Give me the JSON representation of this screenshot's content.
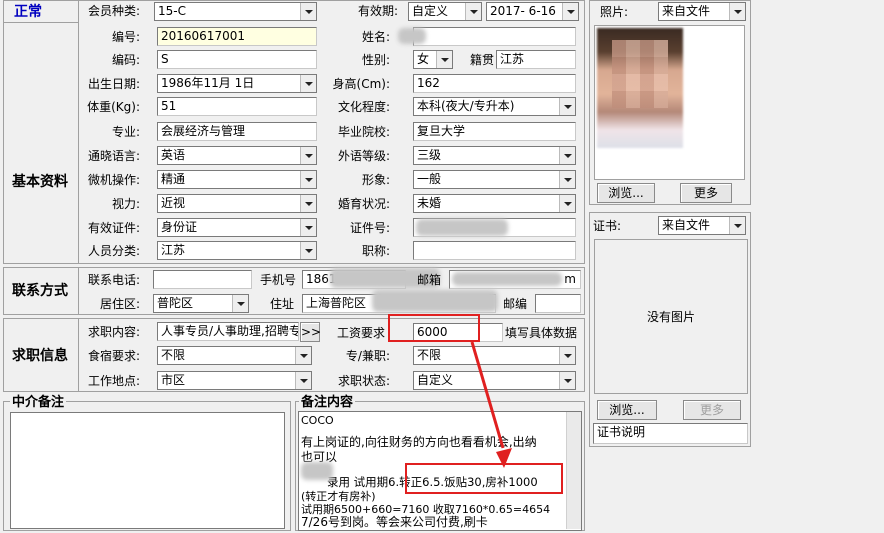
{
  "status": "正常",
  "fields": {
    "member_type_label": "会员种类:",
    "member_type": "15-C",
    "validity_label": "有效期:",
    "validity_select": "自定义",
    "validity_date": "2017- 6-16",
    "id_label": "编号:",
    "id_value": "20160617001",
    "name_label": "姓名:",
    "code_label": "编码:",
    "code_value": "S",
    "gender_label": "性别:",
    "gender_value": "女",
    "native_label": "籍贯",
    "native_value": "江苏",
    "birth_label": "出生日期:",
    "birth_value": "1986年11月 1日",
    "height_label": "身高(Cm):",
    "height_value": "162",
    "weight_label": "体重(Kg):",
    "weight_value": "51",
    "education_label": "文化程度:",
    "education_value": "本科(夜大/专升本)",
    "major_label": "专业:",
    "major_value": "会展经济与管理",
    "school_label": "毕业院校:",
    "school_value": "复旦大学",
    "language_label": "通晓语言:",
    "language_value": "英语",
    "language_level_label": "外语等级:",
    "language_level_value": "三级",
    "computer_label": "微机操作:",
    "computer_value": "精通",
    "image_label": "形象:",
    "image_value": "一般",
    "vision_label": "视力:",
    "vision_value": "近视",
    "marital_label": "婚育状况:",
    "marital_value": "未婚",
    "doc_label": "有效证件:",
    "doc_value": "身份证",
    "docno_label": "证件号:",
    "category_label": "人员分类:",
    "category_value": "江苏",
    "title_label": "职称:"
  },
  "basic_section": "基本资料",
  "contact": {
    "section": "联系方式",
    "phone_label": "联系电话:",
    "mobile_label": "手机号",
    "mobile_value": "1861",
    "email_label": "邮箱",
    "email_value": "m",
    "area_label": "居住区:",
    "area_value": "普陀区",
    "address_label": "住址",
    "address_value": "上海普陀区",
    "zip_label": "邮编"
  },
  "job": {
    "section": "求职信息",
    "content_label": "求职内容:",
    "content_value": "人事专员/人事助理,招聘专",
    "more_btn": ">>",
    "salary_label": "工资要求",
    "salary_value": "6000",
    "salary_hint": "填写具体数据",
    "board_label": "食宿要求:",
    "board_value": "不限",
    "type_label": "专/兼职:",
    "type_value": "不限",
    "place_label": "工作地点:",
    "place_value": "市区",
    "state_label": "求职状态:",
    "state_value": "自定义"
  },
  "agency_note_title": "中介备注",
  "remarks": {
    "title": "备注内容",
    "line1": "COCO",
    "line2": "有上岗证的,向往财务的方向也看看机会,出纳",
    "line3": "也可以",
    "line4a": "录用 试用期6.",
    "line4b": "转正6.5.饭贴30,房补1000",
    "line5": "(转正才有房补)",
    "line6": "试用期6500+660=7160 收取7160*0.65=4654",
    "line7": "7/26号到岗。等会来公司付费,刷卡"
  },
  "photo": {
    "label": "照片:",
    "source": "来自文件",
    "browse": "浏览...",
    "more": "更多"
  },
  "cert": {
    "label": "证书:",
    "source": "来自文件",
    "no_image": "没有图片",
    "browse": "浏览...",
    "more": "更多",
    "desc": "证书说明"
  }
}
